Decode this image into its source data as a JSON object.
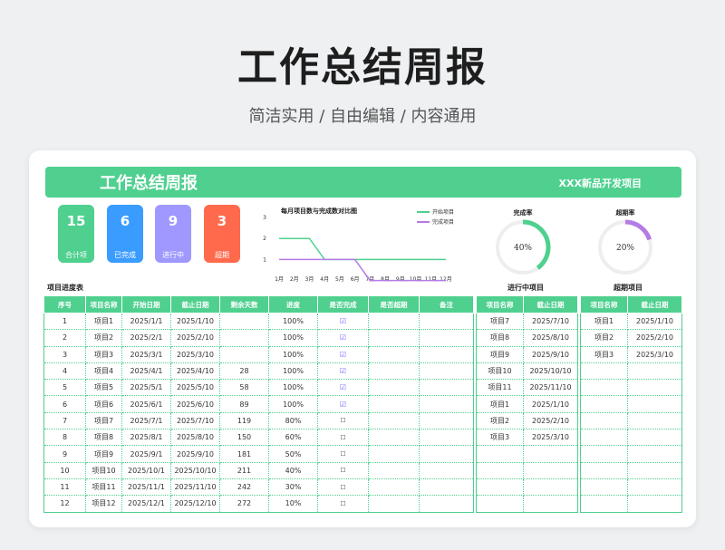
{
  "header": {
    "title": "工作总结周报",
    "subtitle": "简洁实用 / 自由编辑 / 内容通用"
  },
  "banner": {
    "title": "工作总结周报",
    "project": "XXX新品开发项目"
  },
  "stats": [
    {
      "value": "15",
      "label": "合计项",
      "color": "#4fd08f"
    },
    {
      "value": "6",
      "label": "已完成",
      "color": "#3a9cff"
    },
    {
      "value": "9",
      "label": "进行中",
      "color": "#9e98ff"
    },
    {
      "value": "3",
      "label": "超期",
      "color": "#ff6a4d"
    }
  ],
  "chart_data": {
    "type": "line",
    "title": "每月项目数与完成数对比图",
    "categories": [
      "1月",
      "2月",
      "3月",
      "4月",
      "5月",
      "6月",
      "7月",
      "8月",
      "9月",
      "10月",
      "11月",
      "12月"
    ],
    "series": [
      {
        "name": "开始项目",
        "color": "#4fd08f",
        "values": [
          2,
          2,
          2,
          1,
          1,
          1,
          1,
          1,
          1,
          1,
          1,
          1
        ]
      },
      {
        "name": "完成项目",
        "color": "#b57be6",
        "values": [
          1,
          1,
          1,
          1,
          1,
          1,
          0,
          0,
          0,
          0,
          0,
          0
        ]
      }
    ],
    "yticks": [
      1,
      2,
      3
    ],
    "ylim": [
      0.5,
      3
    ]
  },
  "gauges": [
    {
      "title": "完成率",
      "value": 40,
      "label": "40%",
      "color": "#4fd08f"
    },
    {
      "title": "超期率",
      "value": 20,
      "label": "20%",
      "color": "#b57be6"
    }
  ],
  "main_table": {
    "caption": "项目进度表",
    "columns": [
      "序号",
      "项目名称",
      "开始日期",
      "截止日期",
      "剩余天数",
      "进度",
      "是否完成",
      "是否超期",
      "备注"
    ],
    "rows": [
      [
        "1",
        "项目1",
        "2025/1/1",
        "2025/1/10",
        "",
        "100%",
        "☑",
        "",
        ""
      ],
      [
        "2",
        "项目2",
        "2025/2/1",
        "2025/2/10",
        "",
        "100%",
        "☑",
        "",
        ""
      ],
      [
        "3",
        "项目3",
        "2025/3/1",
        "2025/3/10",
        "",
        "100%",
        "☑",
        "",
        ""
      ],
      [
        "4",
        "项目4",
        "2025/4/1",
        "2025/4/10",
        "28",
        "100%",
        "☑",
        "",
        ""
      ],
      [
        "5",
        "项目5",
        "2025/5/1",
        "2025/5/10",
        "58",
        "100%",
        "☑",
        "",
        ""
      ],
      [
        "6",
        "项目6",
        "2025/6/1",
        "2025/6/10",
        "89",
        "100%",
        "☑",
        "",
        ""
      ],
      [
        "7",
        "项目7",
        "2025/7/1",
        "2025/7/10",
        "119",
        "80%",
        "☐",
        "",
        ""
      ],
      [
        "8",
        "项目8",
        "2025/8/1",
        "2025/8/10",
        "150",
        "60%",
        "☐",
        "",
        ""
      ],
      [
        "9",
        "项目9",
        "2025/9/1",
        "2025/9/10",
        "181",
        "50%",
        "☐",
        "",
        ""
      ],
      [
        "10",
        "项目10",
        "2025/10/1",
        "2025/10/10",
        "211",
        "40%",
        "☐",
        "",
        ""
      ],
      [
        "11",
        "项目11",
        "2025/11/1",
        "2025/11/10",
        "242",
        "30%",
        "☐",
        "",
        ""
      ],
      [
        "12",
        "项目12",
        "2025/12/1",
        "2025/12/10",
        "272",
        "10%",
        "☐",
        "",
        ""
      ]
    ]
  },
  "in_progress_table": {
    "caption": "进行中项目",
    "columns": [
      "项目名称",
      "截止日期"
    ],
    "rows": [
      [
        "项目7",
        "2025/7/10"
      ],
      [
        "项目8",
        "2025/8/10"
      ],
      [
        "项目9",
        "2025/9/10"
      ],
      [
        "项目10",
        "2025/10/10"
      ],
      [
        "项目11",
        "2025/11/10"
      ],
      [
        "项目1",
        "2025/1/10"
      ],
      [
        "项目2",
        "2025/2/10"
      ],
      [
        "项目3",
        "2025/3/10"
      ],
      [
        "",
        ""
      ],
      [
        "",
        ""
      ],
      [
        "",
        ""
      ],
      [
        "",
        ""
      ]
    ]
  },
  "overdue_table": {
    "caption": "超期项目",
    "columns": [
      "项目名称",
      "截止日期"
    ],
    "rows": [
      [
        "项目1",
        "2025/1/10"
      ],
      [
        "项目2",
        "2025/2/10"
      ],
      [
        "项目3",
        "2025/3/10"
      ],
      [
        "",
        ""
      ],
      [
        "",
        ""
      ],
      [
        "",
        ""
      ],
      [
        "",
        ""
      ],
      [
        "",
        ""
      ],
      [
        "",
        ""
      ],
      [
        "",
        ""
      ],
      [
        "",
        ""
      ],
      [
        "",
        ""
      ]
    ]
  }
}
